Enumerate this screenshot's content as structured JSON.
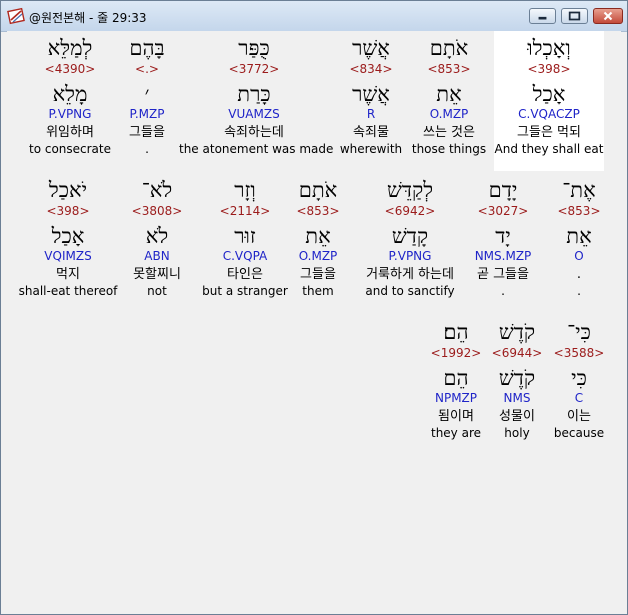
{
  "window": {
    "title": "@원전본해 - 줄 29:33"
  },
  "verse": [
    {
      "heb": "וְאָכְלוּ",
      "strong": "<398>",
      "lemma": "אָכַל",
      "morph": "C.VQACZP",
      "ko": "그들은 먹되",
      "en": "And they shall eat",
      "selected": true
    },
    {
      "heb": "אֹתָם",
      "strong": "<853>",
      "lemma": "אֵת",
      "morph": "O.MZP",
      "ko": "쓰는 것은",
      "en": "those things"
    },
    {
      "heb": "אֲשֶׁר",
      "strong": "<834>",
      "lemma": "אֲשֶׁר",
      "morph": "R",
      "ko": "속죄물",
      "en": "wherewith"
    },
    {
      "heb": "כֻּפַּר",
      "strong": "<3772>",
      "lemma": "כָּרַת",
      "morph": "VUAMZS",
      "ko": "속죄하는데",
      "en": "the atonement was made"
    },
    {
      "heb": "בָּהֶם",
      "strong": "<.>",
      "lemma": "׳",
      "morph": "P.MZP",
      "ko": "그들을",
      "en": "."
    },
    {
      "heb": "לְמַלֵּא",
      "strong": "<4390>",
      "lemma": "מָלֵא",
      "morph": "P.VPNG",
      "ko": "위임하며",
      "en": "to consecrate"
    },
    {
      "heb": "אֶת־",
      "strong": "<853>",
      "lemma": "אֵת",
      "morph": "O",
      "ko": ".",
      "en": "."
    },
    {
      "heb": "יָדָם",
      "strong": "<3027>",
      "lemma": "יָד",
      "morph": "NMS.MZP",
      "ko": "곧 그들을",
      "en": "."
    },
    {
      "heb": "לְקַדֵּשׁ",
      "strong": "<6942>",
      "lemma": "קָדַשׁ",
      "morph": "P.VPNG",
      "ko": "거룩하게 하는데",
      "en": "and to sanctify"
    },
    {
      "heb": "אֹתָם",
      "strong": "<853>",
      "lemma": "אֵת",
      "morph": "O.MZP",
      "ko": "그들을",
      "en": "them"
    },
    {
      "heb": "וְזָר",
      "strong": "<2114>",
      "lemma": "זוּר",
      "morph": "C.VQPA",
      "ko": "타인은",
      "en": "but a stranger"
    },
    {
      "heb": "לֹא־",
      "strong": "<3808>",
      "lemma": "לֹא",
      "morph": "ABN",
      "ko": "못할찌니",
      "en": "not"
    },
    {
      "heb": "יֹאכַל",
      "strong": "<398>",
      "lemma": "אָכַל",
      "morph": "VQIMZS",
      "ko": "먹지",
      "en": "shall-eat thereof"
    },
    {
      "heb": "כִּי־",
      "strong": "<3588>",
      "lemma": "כִּי",
      "morph": "C",
      "ko": "이는",
      "en": "because"
    },
    {
      "heb": "קֹדֶשׁ",
      "strong": "<6944>",
      "lemma": "קֹדֶשׁ",
      "morph": "NMS",
      "ko": "성물이",
      "en": "holy"
    },
    {
      "heb": "הֵם׃",
      "strong": "<1992>",
      "lemma": "הֵם",
      "morph": "NPMZP",
      "ko": "됨이며",
      "en": "they are"
    }
  ]
}
